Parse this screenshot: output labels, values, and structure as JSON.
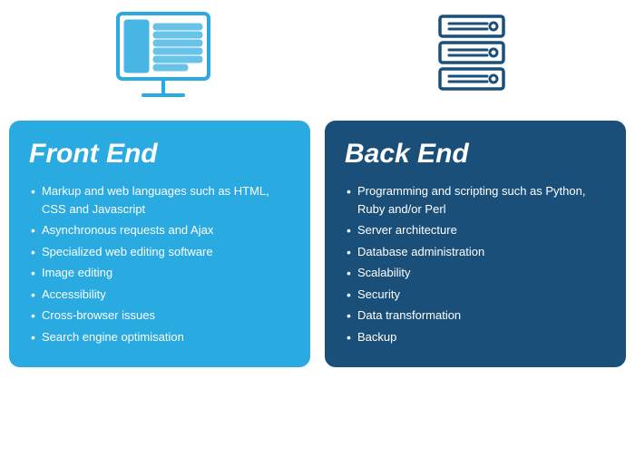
{
  "icons": {
    "front_end_icon": "monitor",
    "back_end_icon": "server"
  },
  "front_end": {
    "title": "Front End",
    "items": [
      "Markup and web languages such as HTML, CSS and Javascript",
      "Asynchronous requests and Ajax",
      "Specialized web editing software",
      "Image editing",
      "Accessibility",
      "Cross-browser issues",
      "Search engine optimisation"
    ]
  },
  "back_end": {
    "title": "Back End",
    "items": [
      "Programming and scripting such as Python, Ruby and/or Perl",
      "Server architecture",
      "Database administration",
      "Scalability",
      "Security",
      "Data transformation",
      "Backup"
    ]
  }
}
